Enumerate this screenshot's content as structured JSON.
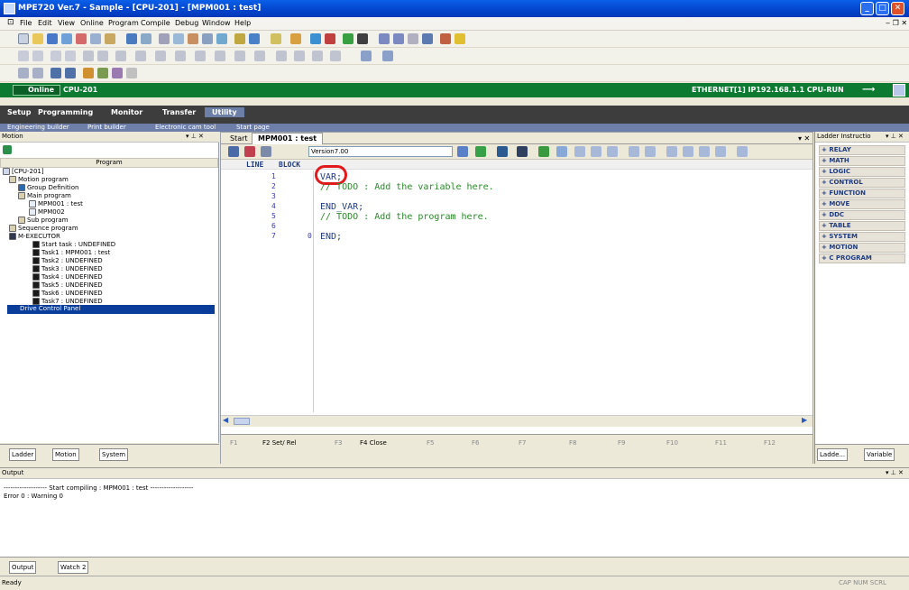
{
  "window": {
    "title": "MPE720 Ver.7 - Sample - [CPU-201] - [MPM001 : test]"
  },
  "menu": [
    "File",
    "Edit",
    "View",
    "Online",
    "Program",
    "Compile",
    "Debug",
    "Window",
    "Help"
  ],
  "online_bar": {
    "status": "Online",
    "cpu": "CPU-201",
    "connection": "ETHERNET[1] IP192.168.1.1 CPU-RUN"
  },
  "main_tabs": [
    "Setup",
    "Programming",
    "Monitor",
    "Transfer",
    "Utility"
  ],
  "sub_tabs": [
    "Engineering builder",
    "Print builder",
    "Electronic cam tool",
    "Start page"
  ],
  "left_pane": {
    "title": "Motion",
    "program_header": "Program",
    "tree": [
      "[CPU-201]",
      "Motion program",
      "Group Definition",
      "Main program",
      "MPM001 : test",
      "MPM002",
      "Sub program",
      "Sequence program",
      "M-EXECUTOR",
      "Start task : UNDEFINED",
      "Task1 : MPM001 : test",
      "Task2 : UNDEFINED",
      "Task3 : UNDEFINED",
      "Task4 : UNDEFINED",
      "Task5 : UNDEFINED",
      "Task6 : UNDEFINED",
      "Task7 : UNDEFINED",
      "Drive Control Panel"
    ],
    "bottom_tabs": [
      "Ladder",
      "Motion",
      "System"
    ]
  },
  "editor": {
    "tabs": [
      "Start",
      "MPM001 : test"
    ],
    "version_select": "Version7.00",
    "col_line": "LINE",
    "col_block": "BLOCK",
    "lines": [
      {
        "line": "1",
        "text": "VAR;"
      },
      {
        "line": "2",
        "text": "// TODO : Add the variable here."
      },
      {
        "line": "3",
        "text": ""
      },
      {
        "line": "4",
        "text": "END_VAR;"
      },
      {
        "line": "5",
        "text": "// TODO : Add the program here."
      },
      {
        "line": "6",
        "text": ""
      },
      {
        "line": "7",
        "block": "0",
        "text": "END;"
      }
    ],
    "fkeys": [
      "F1",
      "F2 Set/ Rel",
      "F3",
      "F4 Close",
      "F5",
      "F6",
      "F7",
      "F8",
      "F9",
      "F10",
      "F11",
      "F12"
    ]
  },
  "right_pane": {
    "title": "Ladder Instructio",
    "categories": [
      "RELAY",
      "MATH",
      "LOGIC",
      "CONTROL",
      "FUNCTION",
      "MOVE",
      "DDC",
      "TABLE",
      "SYSTEM",
      "MOTION",
      "C PROGRAM"
    ],
    "bottom_tabs": [
      "Ladde...",
      "Variable"
    ]
  },
  "output": {
    "title": "Output",
    "lines": [
      "------------------- Start compiling : MPM001 : test -------------------",
      "Error 0 : Warning 0"
    ],
    "bottom_tabs": [
      "Output",
      "Watch 2"
    ]
  },
  "status": {
    "left": "Ready",
    "right": "CAP NUM SCRL"
  },
  "colors": {
    "title_blue": "#0548d0",
    "online_green": "#0c7a30",
    "tab_dark": "#3d3d3d",
    "highlight": "#e31a1c",
    "selection": "#0a3c9a"
  }
}
